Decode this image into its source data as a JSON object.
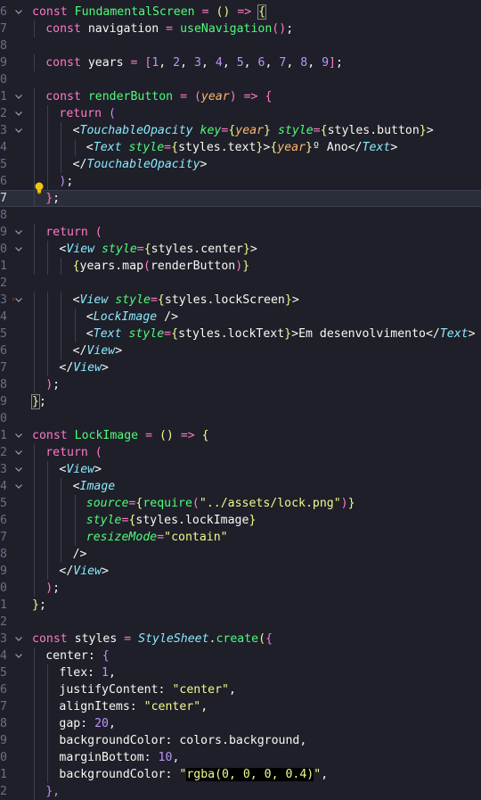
{
  "editor": {
    "lines": [
      {
        "n": "6",
        "fold": "v",
        "indent": 0,
        "tokens": [
          [
            "k",
            "const "
          ],
          [
            "f",
            "FundamentalScreen"
          ],
          [
            "v",
            " "
          ],
          [
            "o",
            "="
          ],
          [
            "v",
            " "
          ],
          [
            "b1",
            "()"
          ],
          [
            "v",
            " "
          ],
          [
            "o",
            "=>"
          ],
          [
            "v",
            " "
          ],
          [
            "b1hl",
            "{"
          ]
        ]
      },
      {
        "n": "7",
        "fold": "",
        "indent": 1,
        "tokens": [
          [
            "k",
            "const "
          ],
          [
            "v",
            "navigation "
          ],
          [
            "o",
            "="
          ],
          [
            "v",
            " "
          ],
          [
            "f",
            "useNavigation"
          ],
          [
            "b2",
            "()"
          ],
          [
            "v",
            ";"
          ]
        ]
      },
      {
        "n": "8",
        "fold": "",
        "indent": 0,
        "tokens": []
      },
      {
        "n": "9",
        "fold": "",
        "indent": 1,
        "tokens": [
          [
            "k",
            "const "
          ],
          [
            "v",
            "years "
          ],
          [
            "o",
            "="
          ],
          [
            "v",
            " "
          ],
          [
            "b2",
            "["
          ],
          [
            "n",
            "1"
          ],
          [
            "v",
            ", "
          ],
          [
            "n",
            "2"
          ],
          [
            "v",
            ", "
          ],
          [
            "n",
            "3"
          ],
          [
            "v",
            ", "
          ],
          [
            "n",
            "4"
          ],
          [
            "v",
            ", "
          ],
          [
            "n",
            "5"
          ],
          [
            "v",
            ", "
          ],
          [
            "n",
            "6"
          ],
          [
            "v",
            ", "
          ],
          [
            "n",
            "7"
          ],
          [
            "v",
            ", "
          ],
          [
            "n",
            "8"
          ],
          [
            "v",
            ", "
          ],
          [
            "n",
            "9"
          ],
          [
            "b2",
            "]"
          ],
          [
            "v",
            ";"
          ]
        ]
      },
      {
        "n": "0",
        "fold": "",
        "indent": 0,
        "tokens": []
      },
      {
        "n": "1",
        "fold": "v",
        "indent": 1,
        "tokens": [
          [
            "k",
            "const "
          ],
          [
            "f",
            "renderButton"
          ],
          [
            "v",
            " "
          ],
          [
            "o",
            "="
          ],
          [
            "v",
            " "
          ],
          [
            "b2",
            "("
          ],
          [
            "p",
            "year"
          ],
          [
            "b2",
            ")"
          ],
          [
            "v",
            " "
          ],
          [
            "o",
            "=>"
          ],
          [
            "v",
            " "
          ],
          [
            "b2",
            "{"
          ]
        ]
      },
      {
        "n": "2",
        "fold": "v",
        "indent": 2,
        "tokens": [
          [
            "k",
            "return "
          ],
          [
            "b3",
            "("
          ]
        ]
      },
      {
        "n": "3",
        "fold": "v",
        "indent": 3,
        "tokens": [
          [
            "v",
            "<"
          ],
          [
            "t",
            "TouchableOpacity"
          ],
          [
            "v",
            " "
          ],
          [
            "a",
            "key"
          ],
          [
            "o",
            "="
          ],
          [
            "b1",
            "{"
          ],
          [
            "p",
            "year"
          ],
          [
            "b1",
            "}"
          ],
          [
            "v",
            " "
          ],
          [
            "a",
            "style"
          ],
          [
            "o",
            "="
          ],
          [
            "b1",
            "{"
          ],
          [
            "v",
            "styles.button"
          ],
          [
            "b1",
            "}"
          ],
          [
            "v",
            ">"
          ]
        ]
      },
      {
        "n": "4",
        "fold": "",
        "indent": 4,
        "tokens": [
          [
            "v",
            "<"
          ],
          [
            "t",
            "Text"
          ],
          [
            "v",
            " "
          ],
          [
            "a",
            "style"
          ],
          [
            "o",
            "="
          ],
          [
            "b1",
            "{"
          ],
          [
            "v",
            "styles.text"
          ],
          [
            "b1",
            "}"
          ],
          [
            "v",
            ">"
          ],
          [
            "b1",
            "{"
          ],
          [
            "p",
            "year"
          ],
          [
            "b1",
            "}"
          ],
          [
            "v",
            "º Ano</"
          ],
          [
            "t",
            "Text"
          ],
          [
            "v",
            ">"
          ]
        ]
      },
      {
        "n": "5",
        "fold": "",
        "indent": 3,
        "tokens": [
          [
            "v",
            "</"
          ],
          [
            "t",
            "TouchableOpacity"
          ],
          [
            "v",
            ">"
          ]
        ]
      },
      {
        "n": "6",
        "fold": "",
        "indent": 2,
        "tokens": [
          [
            "b3",
            ")"
          ],
          [
            "v",
            ";"
          ]
        ]
      },
      {
        "n": "7",
        "fold": "",
        "indent": 1,
        "active": true,
        "tokens": [
          [
            "b2",
            "}"
          ],
          [
            "v",
            ";"
          ]
        ]
      },
      {
        "n": "8",
        "fold": "",
        "indent": 0,
        "tokens": []
      },
      {
        "n": "9",
        "fold": "v",
        "indent": 1,
        "tokens": [
          [
            "k",
            "return "
          ],
          [
            "b2",
            "("
          ]
        ]
      },
      {
        "n": "0",
        "fold": "v",
        "indent": 2,
        "tokens": [
          [
            "v",
            "<"
          ],
          [
            "t",
            "View"
          ],
          [
            "v",
            " "
          ],
          [
            "a",
            "style"
          ],
          [
            "o",
            "="
          ],
          [
            "b1",
            "{"
          ],
          [
            "v",
            "styles.center"
          ],
          [
            "b1",
            "}"
          ],
          [
            "v",
            ">"
          ]
        ]
      },
      {
        "n": "1",
        "fold": "",
        "indent": 3,
        "tokens": [
          [
            "b1",
            "{"
          ],
          [
            "v",
            "years.map"
          ],
          [
            "b2",
            "("
          ],
          [
            "v",
            "renderButton"
          ],
          [
            "b2",
            ")"
          ],
          [
            "b1",
            "}"
          ]
        ]
      },
      {
        "n": "2",
        "fold": "",
        "indent": 0,
        "tokens": []
      },
      {
        "n": "3",
        "fold": "v",
        "indent": 3,
        "tokens": [
          [
            "v",
            "<"
          ],
          [
            "t",
            "View"
          ],
          [
            "v",
            " "
          ],
          [
            "a",
            "style"
          ],
          [
            "o",
            "="
          ],
          [
            "b1",
            "{"
          ],
          [
            "v",
            "styles.lockScreen"
          ],
          [
            "b1",
            "}"
          ],
          [
            "v",
            ">"
          ]
        ]
      },
      {
        "n": "4",
        "fold": "",
        "indent": 4,
        "tokens": [
          [
            "v",
            "<"
          ],
          [
            "t",
            "LockImage"
          ],
          [
            "v",
            " />"
          ]
        ]
      },
      {
        "n": "5",
        "fold": "",
        "indent": 4,
        "tokens": [
          [
            "v",
            "<"
          ],
          [
            "t",
            "Text"
          ],
          [
            "v",
            " "
          ],
          [
            "a",
            "style"
          ],
          [
            "o",
            "="
          ],
          [
            "b1",
            "{"
          ],
          [
            "v",
            "styles.lockText"
          ],
          [
            "b1",
            "}"
          ],
          [
            "v",
            ">Em desenvolvimento</"
          ],
          [
            "t",
            "Text"
          ],
          [
            "v",
            ">"
          ]
        ]
      },
      {
        "n": "6",
        "fold": "",
        "indent": 3,
        "tokens": [
          [
            "v",
            "</"
          ],
          [
            "t",
            "View"
          ],
          [
            "v",
            ">"
          ]
        ]
      },
      {
        "n": "7",
        "fold": "",
        "indent": 2,
        "tokens": [
          [
            "v",
            "</"
          ],
          [
            "t",
            "View"
          ],
          [
            "v",
            ">"
          ]
        ]
      },
      {
        "n": "8",
        "fold": "",
        "indent": 1,
        "tokens": [
          [
            "b2",
            ")"
          ],
          [
            "v",
            ";"
          ]
        ]
      },
      {
        "n": "9",
        "fold": "",
        "indent": 0,
        "tokens": [
          [
            "b1hl",
            "}"
          ],
          [
            "v",
            ";"
          ]
        ]
      },
      {
        "n": "0",
        "fold": "",
        "indent": 0,
        "tokens": []
      },
      {
        "n": "1",
        "fold": "v",
        "indent": 0,
        "tokens": [
          [
            "k",
            "const "
          ],
          [
            "f",
            "LockImage"
          ],
          [
            "v",
            " "
          ],
          [
            "o",
            "="
          ],
          [
            "v",
            " "
          ],
          [
            "b1",
            "()"
          ],
          [
            "v",
            " "
          ],
          [
            "o",
            "=>"
          ],
          [
            "v",
            " "
          ],
          [
            "b1",
            "{"
          ]
        ]
      },
      {
        "n": "2",
        "fold": "v",
        "indent": 1,
        "tokens": [
          [
            "k",
            "return "
          ],
          [
            "b2",
            "("
          ]
        ]
      },
      {
        "n": "3",
        "fold": "v",
        "indent": 2,
        "tokens": [
          [
            "v",
            "<"
          ],
          [
            "t",
            "View"
          ],
          [
            "v",
            ">"
          ]
        ]
      },
      {
        "n": "4",
        "fold": "v",
        "indent": 3,
        "tokens": [
          [
            "v",
            "<"
          ],
          [
            "t",
            "Image"
          ]
        ]
      },
      {
        "n": "5",
        "fold": "",
        "indent": 4,
        "tokens": [
          [
            "a",
            "source"
          ],
          [
            "o",
            "="
          ],
          [
            "b1",
            "{"
          ],
          [
            "f",
            "require"
          ],
          [
            "b2",
            "("
          ],
          [
            "s",
            "\"../assets/lock.png\""
          ],
          [
            "b2",
            ")"
          ],
          [
            "b1",
            "}"
          ]
        ]
      },
      {
        "n": "6",
        "fold": "",
        "indent": 4,
        "tokens": [
          [
            "a",
            "style"
          ],
          [
            "o",
            "="
          ],
          [
            "b1",
            "{"
          ],
          [
            "v",
            "styles.lockImage"
          ],
          [
            "b1",
            "}"
          ]
        ]
      },
      {
        "n": "7",
        "fold": "",
        "indent": 4,
        "tokens": [
          [
            "a",
            "resizeMode"
          ],
          [
            "o",
            "="
          ],
          [
            "s",
            "\"contain\""
          ]
        ]
      },
      {
        "n": "8",
        "fold": "",
        "indent": 3,
        "tokens": [
          [
            "v",
            "/>"
          ]
        ]
      },
      {
        "n": "9",
        "fold": "",
        "indent": 2,
        "tokens": [
          [
            "v",
            "</"
          ],
          [
            "t",
            "View"
          ],
          [
            "v",
            ">"
          ]
        ]
      },
      {
        "n": "0",
        "fold": "",
        "indent": 1,
        "tokens": [
          [
            "b2",
            ")"
          ],
          [
            "v",
            ";"
          ]
        ]
      },
      {
        "n": "1",
        "fold": "",
        "indent": 0,
        "tokens": [
          [
            "b1",
            "}"
          ],
          [
            "v",
            ";"
          ]
        ]
      },
      {
        "n": "2",
        "fold": "",
        "indent": 0,
        "tokens": []
      },
      {
        "n": "3",
        "fold": "v",
        "indent": 0,
        "tokens": [
          [
            "k",
            "const "
          ],
          [
            "v",
            "styles "
          ],
          [
            "o",
            "="
          ],
          [
            "v",
            " "
          ],
          [
            "t",
            "StyleSheet"
          ],
          [
            "v",
            "."
          ],
          [
            "f",
            "create"
          ],
          [
            "b1",
            "("
          ],
          [
            "b2",
            "{"
          ]
        ]
      },
      {
        "n": "4",
        "fold": "v",
        "indent": 1,
        "tokens": [
          [
            "v",
            "center: "
          ],
          [
            "b3",
            "{"
          ]
        ]
      },
      {
        "n": "5",
        "fold": "",
        "indent": 2,
        "tokens": [
          [
            "v",
            "flex: "
          ],
          [
            "n",
            "1"
          ],
          [
            "v",
            ","
          ]
        ]
      },
      {
        "n": "6",
        "fold": "",
        "indent": 2,
        "tokens": [
          [
            "v",
            "justifyContent: "
          ],
          [
            "s",
            "\"center\""
          ],
          [
            "v",
            ","
          ]
        ]
      },
      {
        "n": "7",
        "fold": "",
        "indent": 2,
        "tokens": [
          [
            "v",
            "alignItems: "
          ],
          [
            "s",
            "\"center\""
          ],
          [
            "v",
            ","
          ]
        ]
      },
      {
        "n": "8",
        "fold": "",
        "indent": 2,
        "tokens": [
          [
            "v",
            "gap: "
          ],
          [
            "n",
            "20"
          ],
          [
            "v",
            ","
          ]
        ]
      },
      {
        "n": "9",
        "fold": "",
        "indent": 2,
        "tokens": [
          [
            "v",
            "backgroundColor: colors.background,"
          ]
        ]
      },
      {
        "n": "0",
        "fold": "",
        "indent": 2,
        "tokens": [
          [
            "v",
            "marginBottom: "
          ],
          [
            "n",
            "10"
          ],
          [
            "v",
            ","
          ]
        ]
      },
      {
        "n": "1",
        "fold": "",
        "indent": 2,
        "tokens": [
          [
            "v",
            "backgroundColor: "
          ],
          [
            "s",
            "\""
          ],
          [
            "hl",
            "rgba(0, 0, 0, 0.4)"
          ],
          [
            "s",
            "\""
          ],
          [
            "v",
            ","
          ]
        ]
      },
      {
        "n": "2",
        "fold": "",
        "indent": 1,
        "tokens": [
          [
            "b3",
            "},"
          ]
        ]
      }
    ]
  },
  "icons": {
    "lightbulb": "lightbulb-icon",
    "fold": "chevron-down-icon",
    "error": "error-marker-icon"
  },
  "colors": {
    "background": "#1e1f29",
    "keyword": "#ff79c6",
    "function": "#50fa7b",
    "component": "#8be9fd",
    "string": "#f1fa8c",
    "number": "#bd93f9",
    "param": "#ffb86c"
  }
}
